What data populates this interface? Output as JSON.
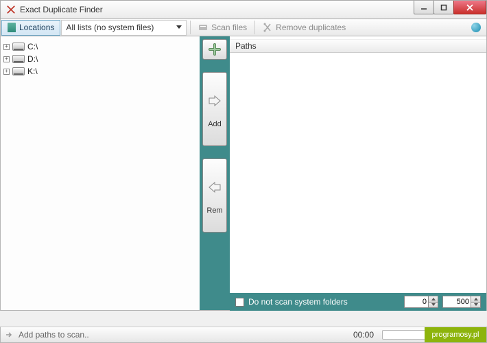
{
  "window": {
    "title": "Exact Duplicate Finder"
  },
  "toolbar": {
    "locations_label": "Locations",
    "dropdown_value": "All lists (no system files)",
    "scan_label": "Scan files",
    "remove_label": "Remove duplicates"
  },
  "tree": {
    "drives": [
      "C:\\",
      "D:\\",
      "K:\\"
    ]
  },
  "center": {
    "add_label": "Add",
    "rem_label": "Rem"
  },
  "right": {
    "paths_header": "Paths"
  },
  "bottom": {
    "checkbox_label": "Do not scan system folders",
    "spinner1": "0",
    "spinner2": "500"
  },
  "status": {
    "text": "Add paths to scan..",
    "time": "00:00"
  },
  "watermark": "programosy.pl"
}
